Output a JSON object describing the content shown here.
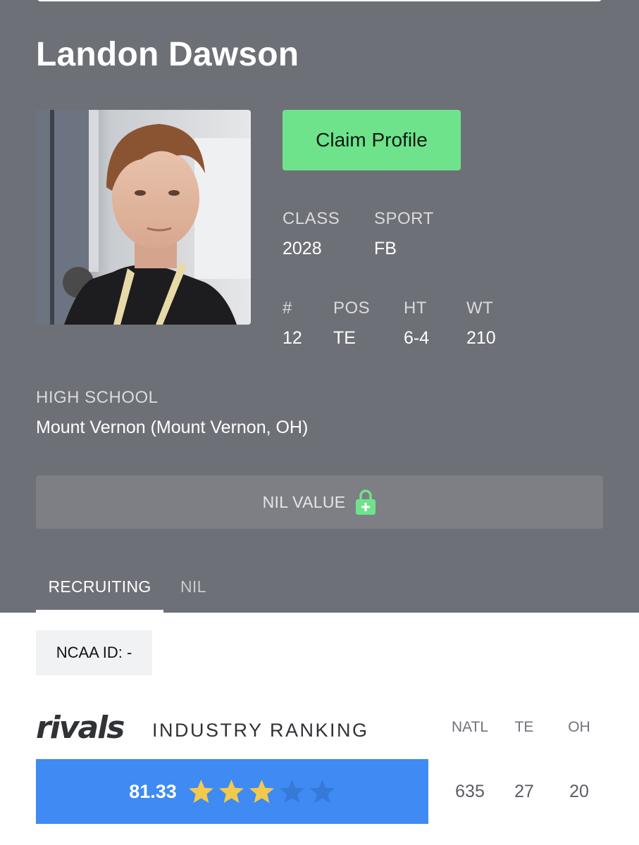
{
  "player": {
    "name": "Landon Dawson"
  },
  "actions": {
    "claim_label": "Claim Profile"
  },
  "stats": {
    "class_label": "CLASS",
    "class_value": "2028",
    "sport_label": "SPORT",
    "sport_value": "FB",
    "number_label": "#",
    "number_value": "12",
    "pos_label": "POS",
    "pos_value": "TE",
    "ht_label": "HT",
    "ht_value": "6-4",
    "wt_label": "WT",
    "wt_value": "210"
  },
  "high_school": {
    "label": "HIGH SCHOOL",
    "value": "Mount Vernon (Mount Vernon, OH)"
  },
  "nil": {
    "label": "NIL VALUE",
    "icon": "lock-plus-icon",
    "icon_color": "#6fe38b"
  },
  "tabs": [
    {
      "label": "RECRUITING",
      "active": true
    },
    {
      "label": "NIL",
      "active": false
    }
  ],
  "ncaa": {
    "text": "NCAA ID:  -"
  },
  "ranking": {
    "logo_text": "rivals",
    "title": "INDUSTRY RANKING",
    "score": "81.33",
    "stars_filled": 3,
    "stars_total": 5,
    "star_color": "#f4c84b",
    "bar_color": "#3f8af3",
    "columns": [
      {
        "head": "NATL",
        "value": "635"
      },
      {
        "head": "TE",
        "value": "27"
      },
      {
        "head": "OH",
        "value": "20"
      }
    ]
  }
}
